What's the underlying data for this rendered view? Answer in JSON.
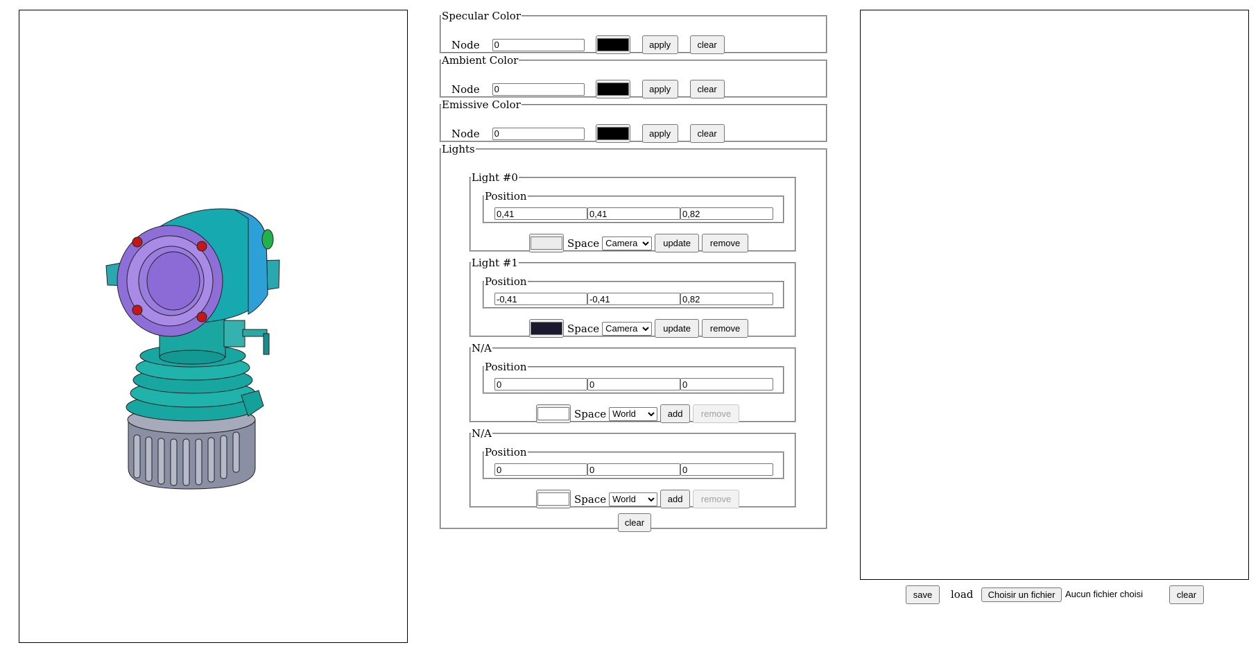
{
  "colors": {
    "specular": "#000000",
    "ambient": "#000000",
    "emissive": "#000000"
  },
  "specular": {
    "legend": "Specular Color",
    "node_label": "Node",
    "node_value": "0",
    "apply": "apply",
    "clear": "clear"
  },
  "ambient": {
    "legend": "Ambient Color",
    "node_label": "Node",
    "node_value": "0",
    "apply": "apply",
    "clear": "clear"
  },
  "emissive": {
    "legend": "Emissive Color",
    "node_label": "Node",
    "node_value": "0",
    "apply": "apply",
    "clear": "clear"
  },
  "lights": {
    "legend": "Lights",
    "clear": "clear",
    "items": [
      {
        "legend": "Light #0",
        "position_legend": "Position",
        "x": "0,41",
        "y": "0,41",
        "z": "0,82",
        "color": "#ececec",
        "space_label": "Space",
        "space_value": "Camera",
        "primary": "update",
        "secondary": "remove"
      },
      {
        "legend": "Light #1",
        "position_legend": "Position",
        "x": "-0,41",
        "y": "-0,41",
        "z": "0,82",
        "color": "#1a1a2e",
        "space_label": "Space",
        "space_value": "Camera",
        "primary": "update",
        "secondary": "remove"
      },
      {
        "legend": "N/A",
        "position_legend": "Position",
        "x": "0",
        "y": "0",
        "z": "0",
        "color": "#ffffff",
        "space_label": "Space",
        "space_value": "World",
        "primary": "add",
        "secondary": "remove"
      },
      {
        "legend": "N/A",
        "position_legend": "Position",
        "x": "0",
        "y": "0",
        "z": "0",
        "color": "#ffffff",
        "space_label": "Space",
        "space_value": "World",
        "primary": "add",
        "secondary": "remove"
      }
    ]
  },
  "footer": {
    "save": "save",
    "load": "load",
    "choose_file": "Choisir un fichier",
    "no_file": "Aucun fichier choisi",
    "clear": "clear"
  }
}
